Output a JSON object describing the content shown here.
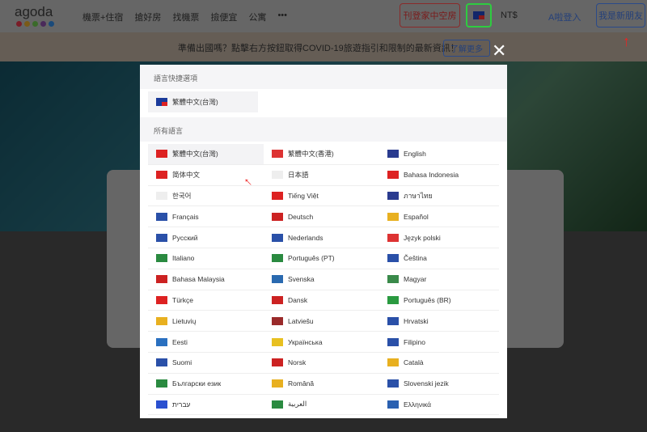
{
  "header": {
    "logo": "agoda",
    "nav": [
      "機票+住宿",
      "搶好房",
      "找機票",
      "撿便宜",
      "公寓",
      "•••"
    ],
    "favorites": "刊登家中空房",
    "currency": "NT$",
    "login": "A啦登入",
    "signup": "我是新朋友"
  },
  "banner": {
    "text": "準備出國嗎？點擊右方按鈕取得COVID-19旅遊指引和限制的最新資訊！",
    "button": "了解更多"
  },
  "modal": {
    "close": "✕",
    "quick_title": "語言快捷選項",
    "quick_item": "繁體中文(台灣)",
    "all_title": "所有語言",
    "languages": [
      {
        "label": "繁體中文(台灣)",
        "flag": "#d22"
      },
      {
        "label": "繁體中文(香港)",
        "flag": "#d33"
      },
      {
        "label": "English",
        "flag": "#2a3b8f"
      },
      {
        "label": "简体中文",
        "flag": "#d22"
      },
      {
        "label": "日本語",
        "flag": "#eee"
      },
      {
        "label": "Bahasa Indonesia",
        "flag": "#d22"
      },
      {
        "label": "한국어",
        "flag": "#eee"
      },
      {
        "label": "Tiếng Việt",
        "flag": "#d22"
      },
      {
        "label": "ภาษาไทย",
        "flag": "#2a3b8f"
      },
      {
        "label": "Français",
        "flag": "#2a50a8"
      },
      {
        "label": "Deutsch",
        "flag": "#c22"
      },
      {
        "label": "Español",
        "flag": "#e8b020"
      },
      {
        "label": "Русский",
        "flag": "#2a50a8"
      },
      {
        "label": "Nederlands",
        "flag": "#2a50a8"
      },
      {
        "label": "Język polski",
        "flag": "#d33"
      },
      {
        "label": "Italiano",
        "flag": "#2a8a40"
      },
      {
        "label": "Português (PT)",
        "flag": "#2a8a40"
      },
      {
        "label": "Čeština",
        "flag": "#2a50a8"
      },
      {
        "label": "Bahasa Malaysia",
        "flag": "#c22"
      },
      {
        "label": "Svenska",
        "flag": "#2a6ab0"
      },
      {
        "label": "Magyar",
        "flag": "#3a8a4a"
      },
      {
        "label": "Türkçe",
        "flag": "#d22"
      },
      {
        "label": "Dansk",
        "flag": "#c22"
      },
      {
        "label": "Português (BR)",
        "flag": "#2a9a40"
      },
      {
        "label": "Lietuvių",
        "flag": "#e8b020"
      },
      {
        "label": "Latviešu",
        "flag": "#9a2a2a"
      },
      {
        "label": "Hrvatski",
        "flag": "#2a50a8"
      },
      {
        "label": "Eesti",
        "flag": "#2a70c0"
      },
      {
        "label": "Українська",
        "flag": "#e8c020"
      },
      {
        "label": "Filipino",
        "flag": "#2a50a8"
      },
      {
        "label": "Suomi",
        "flag": "#2a50a8"
      },
      {
        "label": "Norsk",
        "flag": "#c22"
      },
      {
        "label": "Català",
        "flag": "#e8b020"
      },
      {
        "label": "Български език",
        "flag": "#2a8a40"
      },
      {
        "label": "Română",
        "flag": "#e8b020"
      },
      {
        "label": "Slovenski jezik",
        "flag": "#2a50a8"
      },
      {
        "label": "עברית",
        "flag": "#2a50d0"
      },
      {
        "label": "العربية",
        "flag": "#2a8a40"
      },
      {
        "label": "Ελληνικά",
        "flag": "#2a60b0"
      }
    ]
  }
}
